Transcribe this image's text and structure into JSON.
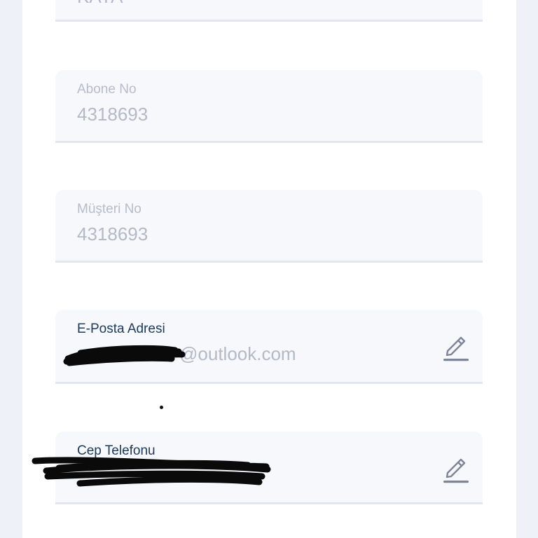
{
  "fields": {
    "partial_top": {
      "value": "KAYA"
    },
    "abone": {
      "label": "Abone No",
      "value": "4318693"
    },
    "musteri": {
      "label": "Müşteri No",
      "value": "4318693"
    },
    "email": {
      "label": "E-Posta Adresi",
      "value": "@outlook.com",
      "edit_icon": "pencil-icon"
    },
    "phone": {
      "label": "Cep Telefonu",
      "value": "",
      "edit_icon": "pencil-icon"
    }
  },
  "colors": {
    "page_bg": "#eef1f8",
    "panel_bg": "#ffffff",
    "field_bg": "#f7f8fc",
    "label_active": "#1b3a5c",
    "text_disabled": "#b3b9c6",
    "icon": "#7d8596"
  }
}
